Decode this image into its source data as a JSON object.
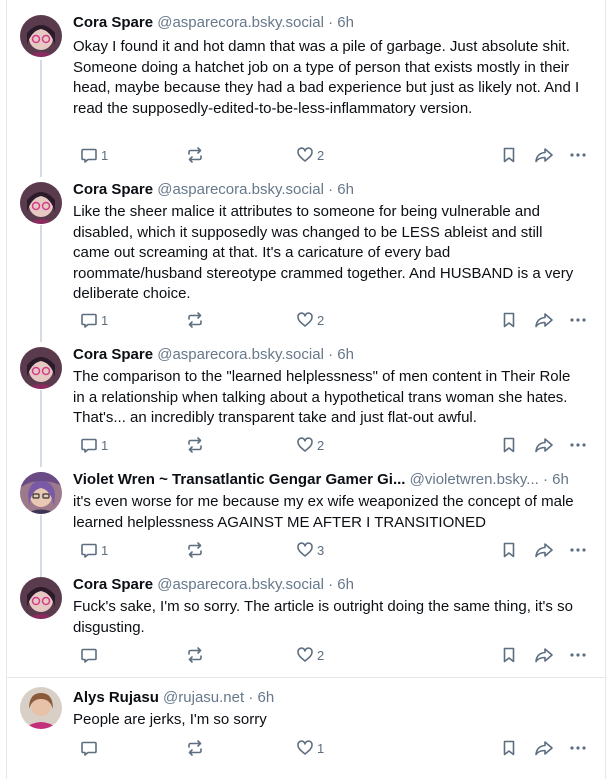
{
  "posts": [
    {
      "author": "Cora Spare",
      "handle": "@asparecora.bsky.social",
      "time": "6h",
      "text": "Okay I found it and hot damn that was a pile of garbage. Just absolute shit. Someone doing a hatchet job on a type of person that exists mostly in their head, maybe because they had a bad experience but just as likely not. And I read the supposedly-edited-to-be-less-inflammatory version.",
      "replies": "1",
      "reposts": "",
      "likes": "2"
    },
    {
      "author": "Cora Spare",
      "handle": "@asparecora.bsky.social",
      "time": "6h",
      "text": "Like the sheer malice it attributes to someone for being vulnerable and disabled, which it supposedly was changed to be LESS ableist and still came out screaming at that. It's a caricature of every bad roommate/husband stereotype crammed together. And HUSBAND is a very deliberate choice.",
      "replies": "1",
      "reposts": "",
      "likes": "2"
    },
    {
      "author": "Cora Spare",
      "handle": "@asparecora.bsky.social",
      "time": "6h",
      "text": "The comparison to the \"learned helplessness\" of men content in Their Role in a relationship when talking about a hypothetical trans woman she hates. That's... an incredibly transparent take and just flat-out awful.",
      "replies": "1",
      "reposts": "",
      "likes": "2"
    },
    {
      "author": "Violet Wren ~ Transatlantic Gengar Gamer Gi...",
      "handle": "@violetwren.bsky...",
      "time": "6h",
      "text": "it's even worse for me because my ex wife weaponized the concept of male learned helplessness AGAINST ME AFTER I TRANSITIONED",
      "replies": "1",
      "reposts": "",
      "likes": "3"
    },
    {
      "author": "Cora Spare",
      "handle": "@asparecora.bsky.social",
      "time": "6h",
      "text": "Fuck's sake, I'm so sorry. The article is outright doing the same thing, it's so disgusting.",
      "replies": "",
      "reposts": "",
      "likes": "2"
    },
    {
      "author": "Alys Rujasu",
      "handle": "@rujasu.net",
      "time": "6h",
      "text": "People are jerks, I'm so sorry",
      "replies": "",
      "reposts": "",
      "likes": "1"
    }
  ],
  "separator": "·",
  "icons": {
    "reply": "reply-icon",
    "repost": "repost-icon",
    "like": "heart-icon",
    "bookmark": "bookmark-icon",
    "share": "share-icon",
    "more": "more-icon"
  },
  "colors": {
    "text": "#0b0f14",
    "muted": "#66788a",
    "icon": "#5d6e80",
    "divider": "#e4e8ec",
    "thread_line": "#d4dbe2"
  }
}
